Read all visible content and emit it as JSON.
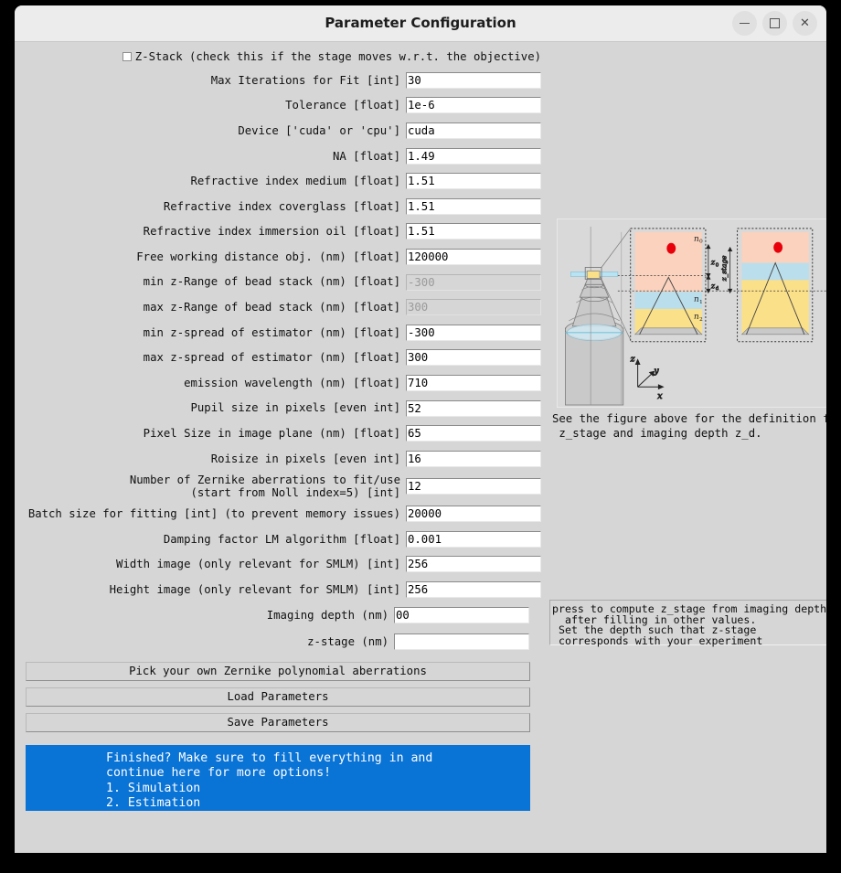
{
  "window": {
    "title": "Parameter Configuration",
    "controls": [
      {
        "name": "minimize",
        "glyph": "–"
      },
      {
        "name": "maximize",
        "glyph": "□"
      },
      {
        "name": "close",
        "glyph": "✕"
      }
    ]
  },
  "zstack": {
    "label": "Z-Stack (check this if the stage moves w.r.t. the objective)",
    "checked": false
  },
  "fields": [
    {
      "label": "Max Iterations for Fit [int]",
      "value": "30",
      "disabled": false
    },
    {
      "label": "Tolerance [float]",
      "value": "1e-6",
      "disabled": false
    },
    {
      "label": "Device ['cuda' or 'cpu']",
      "value": "cuda",
      "disabled": false
    },
    {
      "label": "NA [float]",
      "value": "1.49",
      "disabled": false
    },
    {
      "label": "Refractive index medium [float]",
      "value": "1.51",
      "disabled": false
    },
    {
      "label": "Refractive index coverglass [float]",
      "value": "1.51",
      "disabled": false
    },
    {
      "label": "Refractive index immersion oil [float]",
      "value": "1.51",
      "disabled": false
    },
    {
      "label": "Free working distance obj. (nm) [float]",
      "value": "120000",
      "disabled": false
    },
    {
      "label": "min z-Range of bead stack (nm) [float]",
      "value": "-300",
      "disabled": true
    },
    {
      "label": "max z-Range of bead stack (nm) [float]",
      "value": "300",
      "disabled": true
    },
    {
      "label": "min z-spread of estimator (nm) [float]",
      "value": "-300",
      "disabled": false
    },
    {
      "label": "max z-spread of estimator (nm) [float]",
      "value": "300",
      "disabled": false
    },
    {
      "label": "emission wavelength (nm) [float]",
      "value": "710",
      "disabled": false
    },
    {
      "label": "Pupil size in pixels [even int]",
      "value": "52",
      "disabled": false
    },
    {
      "label": "Pixel Size in image plane (nm) [float]",
      "value": "65",
      "disabled": false
    },
    {
      "label": "Roisize in pixels [even int]",
      "value": "16",
      "disabled": false
    },
    {
      "label": "Number of Zernike aberrations to fit/use\n(start from Noll index=5) [int]",
      "value": "12",
      "disabled": false
    },
    {
      "label": "Batch size for fitting [int] (to prevent memory issues)",
      "value": "20000",
      "disabled": false
    },
    {
      "label": "Damping factor LM algorithm [float]",
      "value": "0.001",
      "disabled": false
    },
    {
      "label": "Width image (only relevant for SMLM) [int]",
      "value": "256",
      "disabled": false
    },
    {
      "label": "Height image (only relevant for SMLM) [int]",
      "value": "256",
      "disabled": false
    }
  ],
  "depth_fields": [
    {
      "label": "Imaging depth (nm)",
      "value": "00"
    },
    {
      "label": "z-stage (nm)",
      "value": ""
    }
  ],
  "buttons": [
    {
      "label": "Pick your own Zernike polynomial aberrations"
    },
    {
      "label": "Load Parameters"
    },
    {
      "label": "Save Parameters"
    }
  ],
  "banner": {
    "text": "Finished? Make sure to fill everything in and\ncontinue here for more options!\n1. Simulation\n2. Estimation",
    "color": "#0a73d6"
  },
  "figure": {
    "caption": "See the figure above for the definition for\n z_stage and imaging depth z_d.",
    "labels": {
      "n0": "n₀",
      "n1": "n₁",
      "n2": "n₂",
      "z0": "z₀",
      "zstage": "z_stage",
      "zd": "z_d",
      "axis_x": "x",
      "axis_y": "y",
      "axis_z": "z"
    },
    "colors": {
      "medium": "#fad2bd",
      "coverglass": "#badeeb",
      "oil": "#fbe08a",
      "objective": "#c9c9c9",
      "emitter": "#e8000b",
      "background": "#d9d9d9"
    }
  },
  "info_box": {
    "text": "press to compute z_stage from imaging depth\n  after filling in other values.\n Set the depth such that z-stage\n corresponds with your experiment"
  }
}
